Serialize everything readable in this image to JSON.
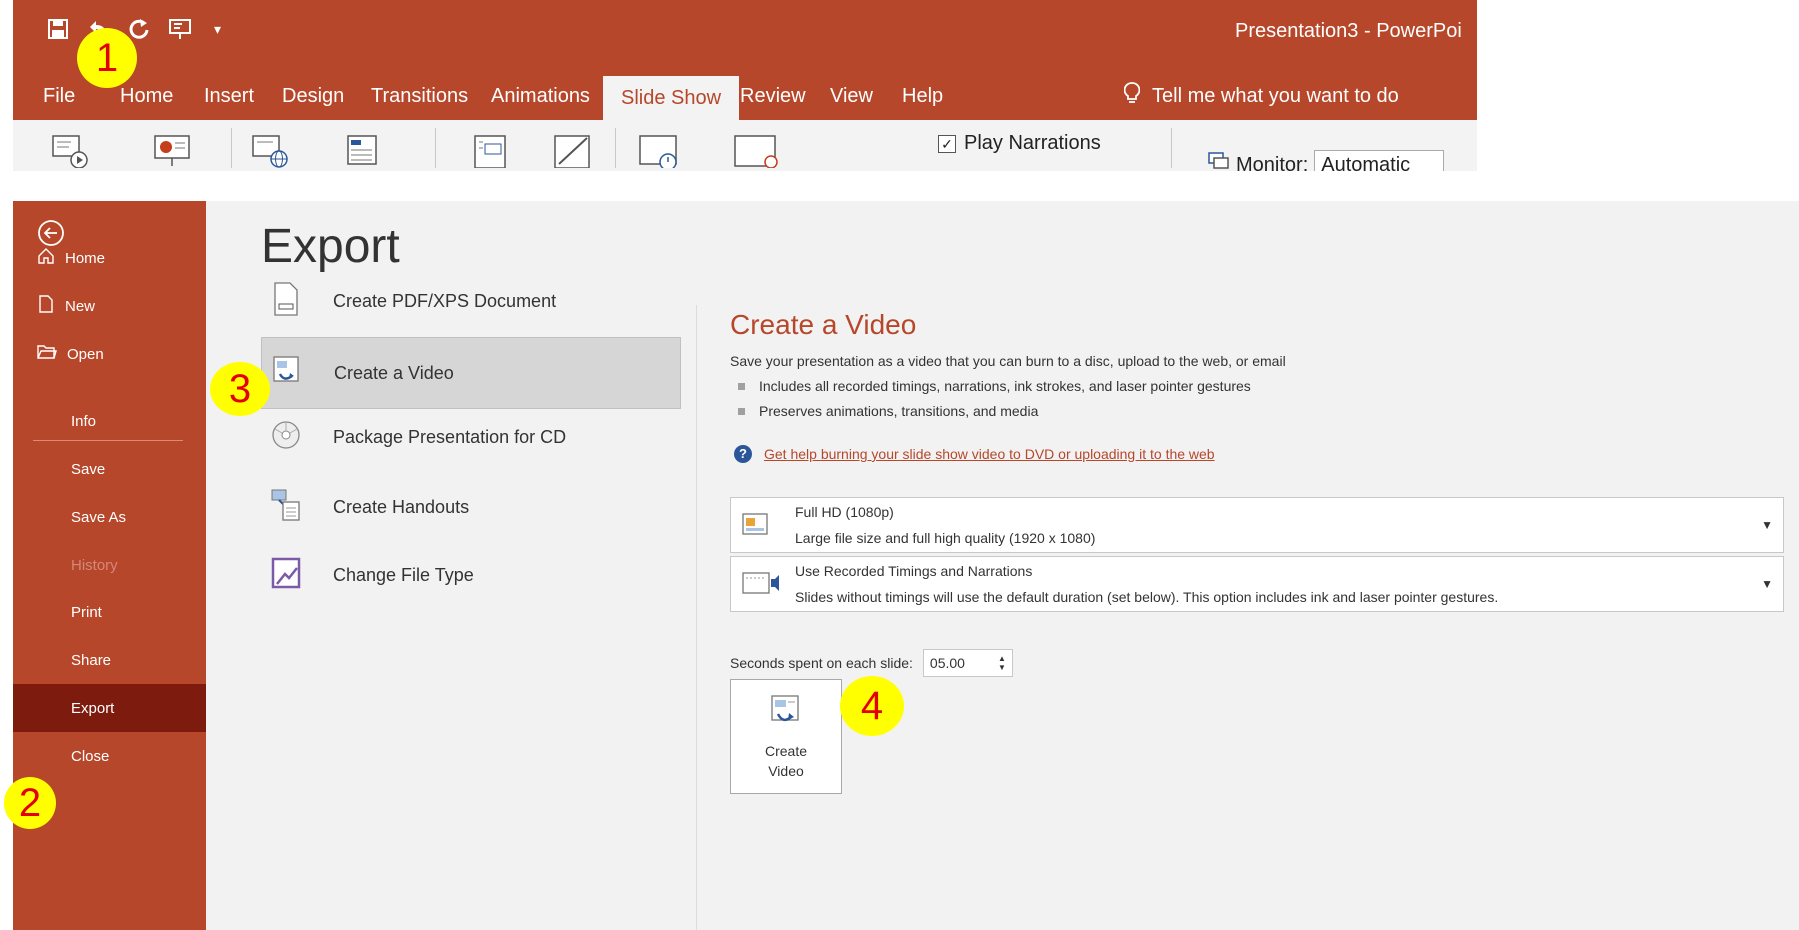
{
  "colors": {
    "accent": "#b7472a",
    "accent_selected": "#7d1b0e",
    "backstage_bg": "#f2f2f2",
    "callout_fill": "#ffff00",
    "callout_text": "#e40000"
  },
  "ribbon": {
    "doc_title": "Presentation3  -  PowerPoi",
    "quick_access": [
      "save-icon",
      "undo-icon",
      "redo-icon",
      "present-icon",
      "customize-icon"
    ],
    "tabs": [
      {
        "label": "File",
        "active": false
      },
      {
        "label": "Home",
        "active": false
      },
      {
        "label": "Insert",
        "active": false
      },
      {
        "label": "Design",
        "active": false
      },
      {
        "label": "Transitions",
        "active": false
      },
      {
        "label": "Animations",
        "active": false
      },
      {
        "label": "Slide Show",
        "active": true
      },
      {
        "label": "Review",
        "active": false
      },
      {
        "label": "View",
        "active": false
      },
      {
        "label": "Help",
        "active": false
      }
    ],
    "tell_me": "Tell me what you want to do",
    "play_narrations": "Play Narrations",
    "monitor_label": "Monitor:",
    "monitor_value": "Automatic"
  },
  "backstage": {
    "sidebar": {
      "items": [
        {
          "label": "Home",
          "icon": "home-icon"
        },
        {
          "label": "New",
          "icon": "new-document-icon"
        },
        {
          "label": "Open",
          "icon": "open-folder-icon"
        },
        {
          "label": "Info"
        },
        {
          "label": "Save"
        },
        {
          "label": "Save As"
        },
        {
          "label": "History",
          "disabled": true
        },
        {
          "label": "Print"
        },
        {
          "label": "Share"
        },
        {
          "label": "Export",
          "selected": true
        },
        {
          "label": "Close"
        }
      ]
    },
    "page_title": "Export",
    "options": [
      {
        "label": "Create PDF/XPS Document",
        "icon": "pdf-document-icon"
      },
      {
        "label": "Create a Video",
        "icon": "video-icon",
        "selected": true
      },
      {
        "label": "Package Presentation for CD",
        "icon": "cd-icon"
      },
      {
        "label": "Create Handouts",
        "icon": "handouts-icon"
      },
      {
        "label": "Change File Type",
        "icon": "file-type-icon"
      }
    ],
    "detail": {
      "title": "Create a Video",
      "description": "Save your presentation as a video that you can burn to a disc, upload to the web, or email",
      "bullets": [
        "Includes all recorded timings, narrations, ink strokes, and laser pointer gestures",
        "Preserves animations, transitions, and media"
      ],
      "help_link": "Get help burning your slide show video to DVD or uploading it to the web",
      "quality": {
        "title": "Full HD (1080p)",
        "subtitle": "Large file size and full high quality (1920 x 1080)"
      },
      "timings": {
        "title": "Use Recorded Timings and Narrations",
        "subtitle": "Slides without timings will use the default duration (set below). This option includes ink and laser pointer gestures."
      },
      "seconds_label": "Seconds spent on each slide:",
      "seconds_value": "05.00",
      "create_button": "Create Video"
    }
  },
  "callouts": [
    "1",
    "2",
    "3",
    "4"
  ]
}
